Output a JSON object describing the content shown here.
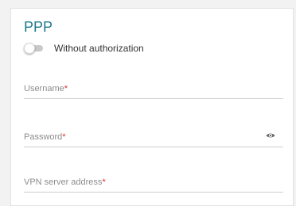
{
  "section": {
    "title": "PPP"
  },
  "authorization": {
    "toggle_label": "Without authorization",
    "enabled": false
  },
  "fields": {
    "username": {
      "label": "Username",
      "required_mark": "*"
    },
    "password": {
      "label": "Password",
      "required_mark": "*",
      "icon": "eye-icon"
    },
    "vpn_server": {
      "label": "VPN server address",
      "required_mark": "*"
    }
  },
  "colors": {
    "accent": "#1f7a8c",
    "required": "#d92f2f"
  }
}
